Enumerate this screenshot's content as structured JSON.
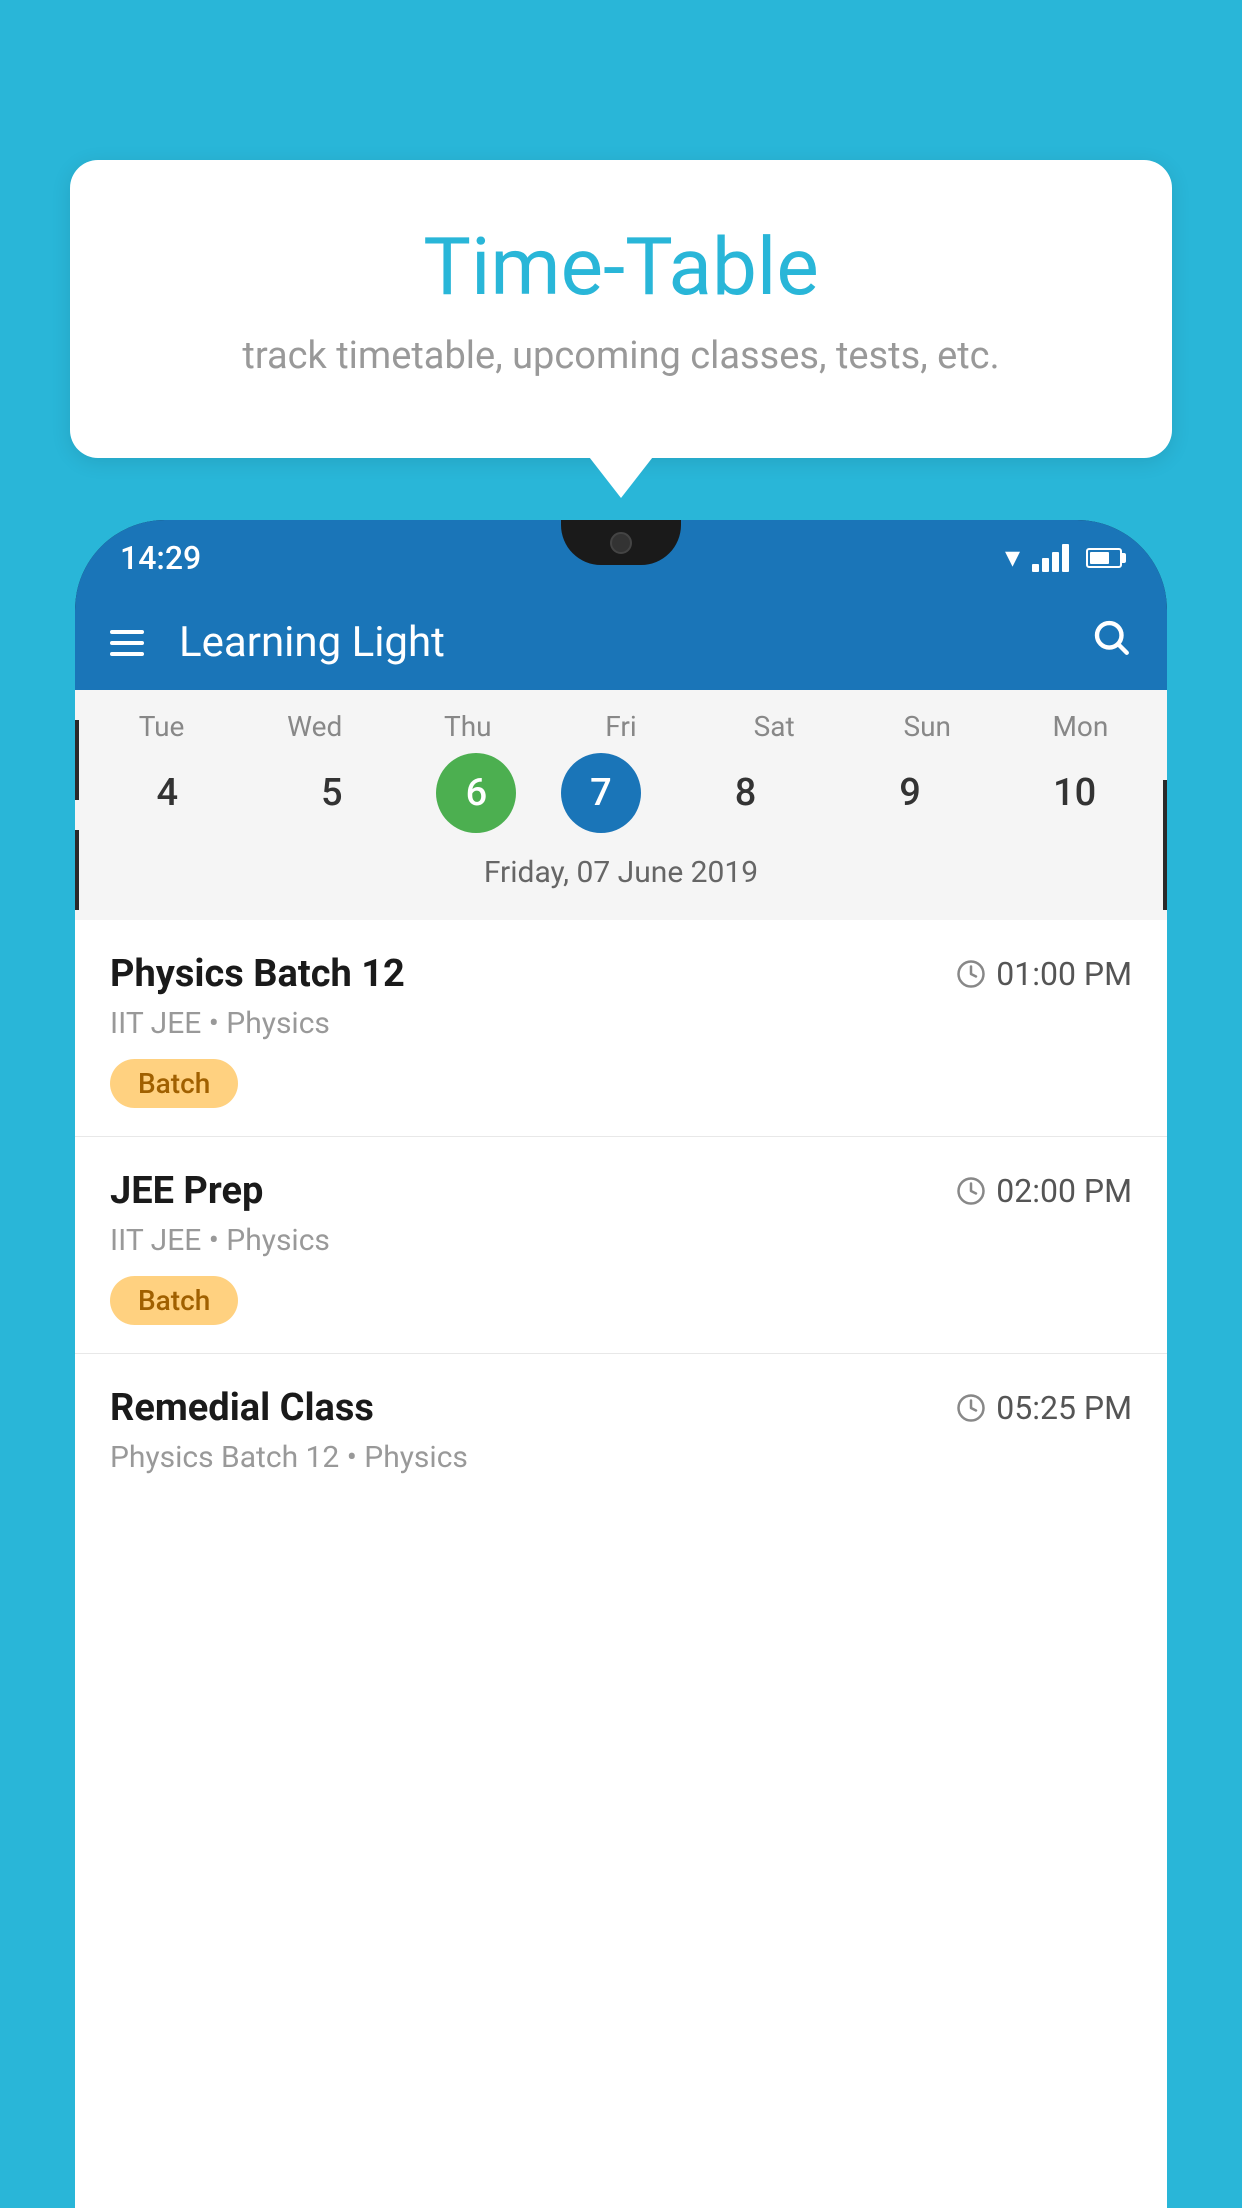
{
  "background_color": "#29b6d8",
  "tooltip": {
    "title": "Time-Table",
    "subtitle": "track timetable, upcoming classes, tests, etc."
  },
  "phone": {
    "status_bar": {
      "time": "14:29"
    },
    "app_bar": {
      "title": "Learning Light"
    },
    "calendar": {
      "days": [
        {
          "label": "Tue",
          "num": "4"
        },
        {
          "label": "Wed",
          "num": "5"
        },
        {
          "label": "Thu",
          "num": "6",
          "state": "today"
        },
        {
          "label": "Fri",
          "num": "7",
          "state": "selected"
        },
        {
          "label": "Sat",
          "num": "8"
        },
        {
          "label": "Sun",
          "num": "9"
        },
        {
          "label": "Mon",
          "num": "10"
        }
      ],
      "selected_date_label": "Friday, 07 June 2019"
    },
    "schedule": [
      {
        "title": "Physics Batch 12",
        "time": "01:00 PM",
        "subtitle": "IIT JEE • Physics",
        "badge": "Batch"
      },
      {
        "title": "JEE Prep",
        "time": "02:00 PM",
        "subtitle": "IIT JEE • Physics",
        "badge": "Batch"
      },
      {
        "title": "Remedial Class",
        "time": "05:25 PM",
        "subtitle": "Physics Batch 12 • Physics",
        "badge": null
      }
    ]
  }
}
